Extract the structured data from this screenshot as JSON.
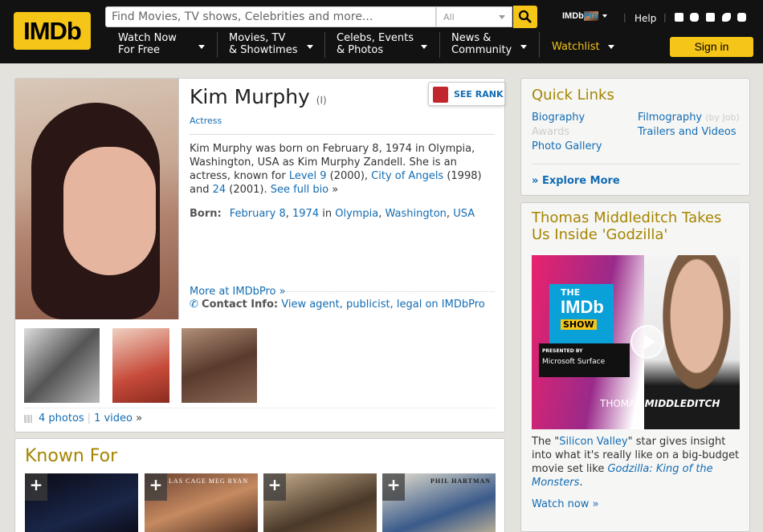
{
  "nav": {
    "logo": "IMDb",
    "search_placeholder": "Find Movies, TV shows, Celebrities and more...",
    "search_category": "All",
    "pro_a": "IMDb",
    "pro_b": "Pro",
    "help": "Help",
    "menu": [
      {
        "l1": "Watch Now",
        "l2": "For Free"
      },
      {
        "l1": "Movies, TV",
        "l2": "& Showtimes"
      },
      {
        "l1": "Celebs, Events",
        "l2": "& Photos"
      },
      {
        "l1": "News &",
        "l2": "Community"
      }
    ],
    "watchlist": "Watchlist",
    "signin": "Sign in"
  },
  "person": {
    "name": "Kim Murphy",
    "roman": "(I)",
    "profession": "Actress",
    "see_rank": "SEE RANK",
    "bio_1": "Kim Murphy was born on February 8, 1974 in Olympia, Washington, USA as Kim Murphy Zandell. She is an actress, known for ",
    "film_1": "Level 9",
    "year_1": " (2000), ",
    "film_2": "City of Angels",
    "year_2": " (1998) and ",
    "film_3": "24",
    "year_3": " (2001). ",
    "full_bio": "See full bio",
    "arrow": "»",
    "born_label": "Born:",
    "born_date": "February 8",
    "born_comma": ", ",
    "born_year": "1974",
    "born_in": " in ",
    "born_place_1": "Olympia",
    "born_place_2": "Washington",
    "born_place_3": "USA",
    "more_pro": "More at IMDbPro",
    "contact_label": "Contact Info:",
    "contact_link": "View agent, publicist, legal on IMDbPro",
    "photos": "4 photos",
    "videos": "1 video"
  },
  "known_for": {
    "title": "Known For",
    "poster_2_text": "LAS CAGE   MEG RYAN",
    "poster_4_text": "PHIL HARTMAN"
  },
  "quick_links": {
    "title": "Quick Links",
    "biography": "Biography",
    "awards": "Awards",
    "photo_gallery": "Photo Gallery",
    "filmography": "Filmography",
    "by_job": "(by Job)",
    "trailers": "Trailers and Videos",
    "explore": "Explore More"
  },
  "news": {
    "title": "Thomas Middleditch Takes Us Inside 'Godzilla'",
    "show_the": "THE",
    "show_imdb": "IMDb",
    "show_show": "SHOW",
    "presented_by": "PRESENTED BY",
    "sponsor": "Microsoft Surface",
    "host_first": "THOMAS ",
    "host_last": "MIDDLEDITCH",
    "text_1": "The \"",
    "show_link": "Silicon Valley",
    "text_2": "\" star gives insight into what it's really like on a big-budget movie set like ",
    "movie_link": "Godzilla: King of the Monsters",
    "text_3": ".",
    "watch_now": "Watch now"
  }
}
